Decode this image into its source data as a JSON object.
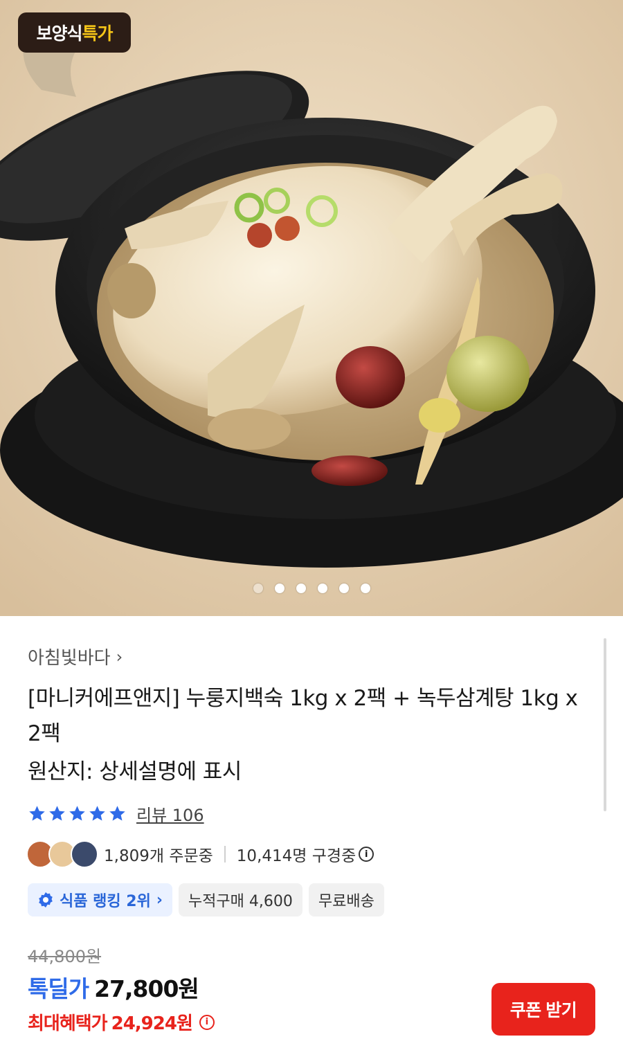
{
  "hero": {
    "badge_part1": "보양식",
    "badge_part2": "특가",
    "carousel_dots": 6,
    "active_dot": 0
  },
  "product": {
    "seller": "아침빛바다",
    "title": "[마니커에프앤지] 누룽지백숙 1kg x 2팩 + 녹두삼계탕 1kg x 2팩",
    "origin": "원산지: 상세설명에 표시",
    "rating_stars": 5,
    "review_label": "리뷰 106",
    "orders": "1,809개 주문중",
    "viewers": "10,414명 구경중",
    "chips": {
      "rank": "식품 랭킹 2위",
      "cumulative": "누적구매 4,600",
      "shipping": "무료배송"
    }
  },
  "pricing": {
    "original_price": "44,800원",
    "deal_label": "톡딜가",
    "deal_price": "27,800원",
    "max_benefit_label": "최대혜택가",
    "max_benefit_price": "24,924원",
    "coupon_button": "쿠폰 받기"
  },
  "colors": {
    "accent_blue": "#2f6be8",
    "accent_red": "#e8231c",
    "star": "#2f6be8"
  }
}
